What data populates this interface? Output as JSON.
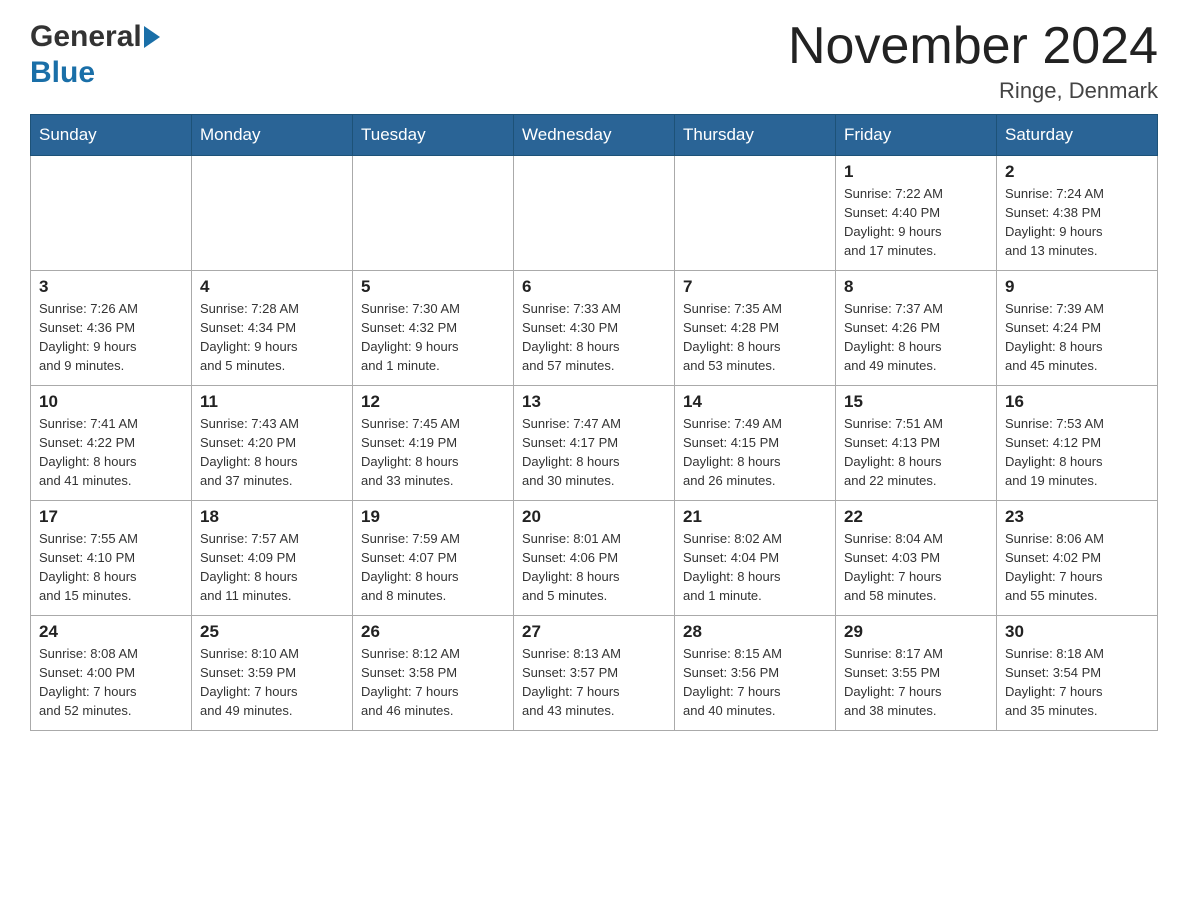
{
  "header": {
    "logo_general": "General",
    "logo_blue": "Blue",
    "month_title": "November 2024",
    "location": "Ringe, Denmark"
  },
  "weekdays": [
    "Sunday",
    "Monday",
    "Tuesday",
    "Wednesday",
    "Thursday",
    "Friday",
    "Saturday"
  ],
  "weeks": [
    [
      {
        "day": "",
        "info": ""
      },
      {
        "day": "",
        "info": ""
      },
      {
        "day": "",
        "info": ""
      },
      {
        "day": "",
        "info": ""
      },
      {
        "day": "",
        "info": ""
      },
      {
        "day": "1",
        "info": "Sunrise: 7:22 AM\nSunset: 4:40 PM\nDaylight: 9 hours\nand 17 minutes."
      },
      {
        "day": "2",
        "info": "Sunrise: 7:24 AM\nSunset: 4:38 PM\nDaylight: 9 hours\nand 13 minutes."
      }
    ],
    [
      {
        "day": "3",
        "info": "Sunrise: 7:26 AM\nSunset: 4:36 PM\nDaylight: 9 hours\nand 9 minutes."
      },
      {
        "day": "4",
        "info": "Sunrise: 7:28 AM\nSunset: 4:34 PM\nDaylight: 9 hours\nand 5 minutes."
      },
      {
        "day": "5",
        "info": "Sunrise: 7:30 AM\nSunset: 4:32 PM\nDaylight: 9 hours\nand 1 minute."
      },
      {
        "day": "6",
        "info": "Sunrise: 7:33 AM\nSunset: 4:30 PM\nDaylight: 8 hours\nand 57 minutes."
      },
      {
        "day": "7",
        "info": "Sunrise: 7:35 AM\nSunset: 4:28 PM\nDaylight: 8 hours\nand 53 minutes."
      },
      {
        "day": "8",
        "info": "Sunrise: 7:37 AM\nSunset: 4:26 PM\nDaylight: 8 hours\nand 49 minutes."
      },
      {
        "day": "9",
        "info": "Sunrise: 7:39 AM\nSunset: 4:24 PM\nDaylight: 8 hours\nand 45 minutes."
      }
    ],
    [
      {
        "day": "10",
        "info": "Sunrise: 7:41 AM\nSunset: 4:22 PM\nDaylight: 8 hours\nand 41 minutes."
      },
      {
        "day": "11",
        "info": "Sunrise: 7:43 AM\nSunset: 4:20 PM\nDaylight: 8 hours\nand 37 minutes."
      },
      {
        "day": "12",
        "info": "Sunrise: 7:45 AM\nSunset: 4:19 PM\nDaylight: 8 hours\nand 33 minutes."
      },
      {
        "day": "13",
        "info": "Sunrise: 7:47 AM\nSunset: 4:17 PM\nDaylight: 8 hours\nand 30 minutes."
      },
      {
        "day": "14",
        "info": "Sunrise: 7:49 AM\nSunset: 4:15 PM\nDaylight: 8 hours\nand 26 minutes."
      },
      {
        "day": "15",
        "info": "Sunrise: 7:51 AM\nSunset: 4:13 PM\nDaylight: 8 hours\nand 22 minutes."
      },
      {
        "day": "16",
        "info": "Sunrise: 7:53 AM\nSunset: 4:12 PM\nDaylight: 8 hours\nand 19 minutes."
      }
    ],
    [
      {
        "day": "17",
        "info": "Sunrise: 7:55 AM\nSunset: 4:10 PM\nDaylight: 8 hours\nand 15 minutes."
      },
      {
        "day": "18",
        "info": "Sunrise: 7:57 AM\nSunset: 4:09 PM\nDaylight: 8 hours\nand 11 minutes."
      },
      {
        "day": "19",
        "info": "Sunrise: 7:59 AM\nSunset: 4:07 PM\nDaylight: 8 hours\nand 8 minutes."
      },
      {
        "day": "20",
        "info": "Sunrise: 8:01 AM\nSunset: 4:06 PM\nDaylight: 8 hours\nand 5 minutes."
      },
      {
        "day": "21",
        "info": "Sunrise: 8:02 AM\nSunset: 4:04 PM\nDaylight: 8 hours\nand 1 minute."
      },
      {
        "day": "22",
        "info": "Sunrise: 8:04 AM\nSunset: 4:03 PM\nDaylight: 7 hours\nand 58 minutes."
      },
      {
        "day": "23",
        "info": "Sunrise: 8:06 AM\nSunset: 4:02 PM\nDaylight: 7 hours\nand 55 minutes."
      }
    ],
    [
      {
        "day": "24",
        "info": "Sunrise: 8:08 AM\nSunset: 4:00 PM\nDaylight: 7 hours\nand 52 minutes."
      },
      {
        "day": "25",
        "info": "Sunrise: 8:10 AM\nSunset: 3:59 PM\nDaylight: 7 hours\nand 49 minutes."
      },
      {
        "day": "26",
        "info": "Sunrise: 8:12 AM\nSunset: 3:58 PM\nDaylight: 7 hours\nand 46 minutes."
      },
      {
        "day": "27",
        "info": "Sunrise: 8:13 AM\nSunset: 3:57 PM\nDaylight: 7 hours\nand 43 minutes."
      },
      {
        "day": "28",
        "info": "Sunrise: 8:15 AM\nSunset: 3:56 PM\nDaylight: 7 hours\nand 40 minutes."
      },
      {
        "day": "29",
        "info": "Sunrise: 8:17 AM\nSunset: 3:55 PM\nDaylight: 7 hours\nand 38 minutes."
      },
      {
        "day": "30",
        "info": "Sunrise: 8:18 AM\nSunset: 3:54 PM\nDaylight: 7 hours\nand 35 minutes."
      }
    ]
  ]
}
